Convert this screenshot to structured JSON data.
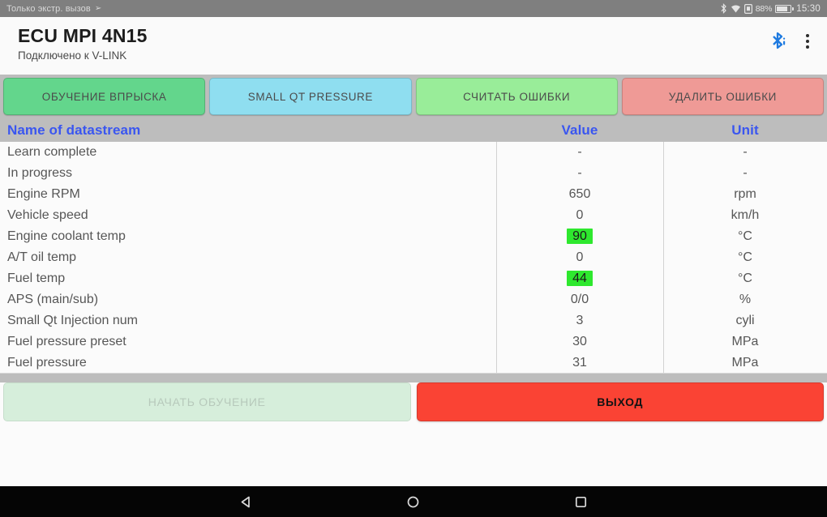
{
  "statusbar": {
    "carrier_text": "Только экстр. вызов",
    "carrier_arrow": "➢",
    "bluetooth_icon": "bluetooth-icon",
    "wifi_icon": "wifi-icon",
    "sim_icon": "sim-card-icon",
    "battery_percent": "88%",
    "battery_icon": "battery-icon",
    "clock": "15:30"
  },
  "appbar": {
    "title": "ECU MPI 4N15",
    "subtitle": "Подключено к V-LINK",
    "bluetooth_icon": "bluetooth-connected-icon",
    "overflow_icon": "overflow-menu-icon",
    "bluetooth_color": "#1e7ae0"
  },
  "action_buttons": [
    {
      "label": "ОБУЧЕНИЕ ВПРЫСКА",
      "color": "#63d68c",
      "style": "green"
    },
    {
      "label": "SMALL QT PRESSURE",
      "color": "#8fdef0",
      "style": "cyan"
    },
    {
      "label": "СЧИТАТЬ ОШИБКИ",
      "color": "#99ed99",
      "style": "lgreen"
    },
    {
      "label": "УДАЛИТЬ ОШИБКИ",
      "color": "#ef9a96",
      "style": "red"
    }
  ],
  "table": {
    "headers": {
      "name": "Name of datastream",
      "value": "Value",
      "unit": "Unit"
    },
    "header_color": "#3a56f0",
    "highlight_color": "#2ee82e",
    "rows": [
      {
        "name": "Learn complete",
        "value": "-",
        "unit": "-",
        "highlight": false
      },
      {
        "name": "In progress",
        "value": "-",
        "unit": "-",
        "highlight": false
      },
      {
        "name": "Engine RPM",
        "value": "650",
        "unit": "rpm",
        "highlight": false
      },
      {
        "name": "Vehicle speed",
        "value": "0",
        "unit": "km/h",
        "highlight": false
      },
      {
        "name": "Engine coolant temp",
        "value": "90",
        "unit": "°C",
        "highlight": true
      },
      {
        "name": "A/T oil temp",
        "value": "0",
        "unit": "°C",
        "highlight": false
      },
      {
        "name": "Fuel temp",
        "value": "44",
        "unit": "°C",
        "highlight": true
      },
      {
        "name": "APS (main/sub)",
        "value": "0/0",
        "unit": "%",
        "highlight": false
      },
      {
        "name": "Small Qt Injection num",
        "value": "3",
        "unit": "cyli",
        "highlight": false
      },
      {
        "name": "Fuel pressure preset",
        "value": "30",
        "unit": "MPa",
        "highlight": false
      },
      {
        "name": "Fuel pressure",
        "value": "31",
        "unit": "MPa",
        "highlight": false
      }
    ]
  },
  "bottom_buttons": [
    {
      "label": "НАЧАТЬ ОБУЧЕНИЕ",
      "style": "disabled",
      "color": "#d6eedb"
    },
    {
      "label": "ВЫХОД",
      "style": "danger",
      "color": "#fa4334"
    }
  ],
  "navbar": {
    "back_icon": "back-triangle-icon",
    "home_icon": "home-circle-icon",
    "recents_icon": "recents-square-icon"
  }
}
